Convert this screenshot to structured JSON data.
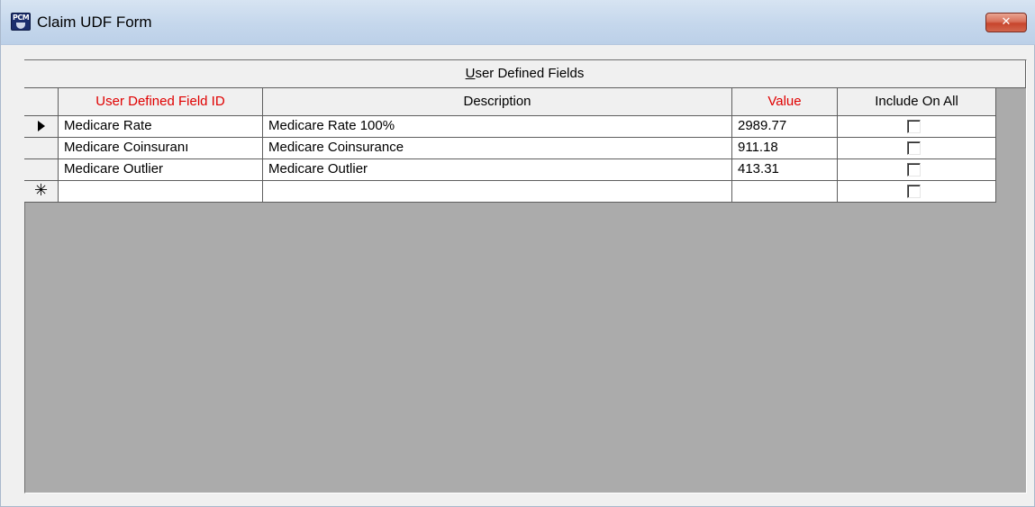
{
  "window": {
    "title": "Claim UDF Form",
    "icon_text": "PCM",
    "close_glyph": "✕"
  },
  "grid": {
    "caption_accel": "U",
    "caption_rest": "ser Defined Fields",
    "columns": [
      {
        "label": "User Defined Field ID",
        "color": "#e00000"
      },
      {
        "label": "Description",
        "color": "#000000"
      },
      {
        "label": "Value",
        "color": "#e00000"
      },
      {
        "label": "Include On All",
        "color": "#000000"
      }
    ],
    "rows": [
      {
        "selector": "current-row-arrow",
        "id": "Medicare Rate",
        "description": "Medicare Rate 100%",
        "value": "2989.77",
        "include_on_all": false
      },
      {
        "selector": "",
        "id": "Medicare Coinsuranı",
        "description": "Medicare Coinsurance",
        "value": "911.18",
        "include_on_all": false
      },
      {
        "selector": "",
        "id": "Medicare Outlier",
        "description": "Medicare Outlier",
        "value": "413.31",
        "include_on_all": false
      },
      {
        "selector": "new-row",
        "selector_glyph": "✳",
        "id": "",
        "description": "",
        "value": "",
        "include_on_all": false
      }
    ]
  },
  "colors": {
    "required_header": "#e00000",
    "grid_background": "#ababab"
  }
}
